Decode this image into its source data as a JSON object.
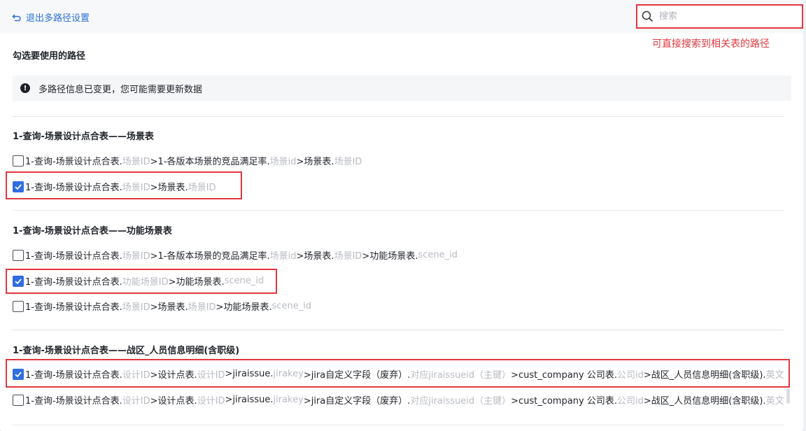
{
  "header": {
    "back_label": "退出多路径设置",
    "search_placeholder": "搜索",
    "search_annotation": "可直接搜索到相关表的路径"
  },
  "section_label": "勾选要使用的路径",
  "notice": "多路径信息已变更，您可能需要更新数据",
  "groups": [
    {
      "title": "1-查询-场景设计点合表——场景表",
      "rows": [
        {
          "checked": false,
          "segments": [
            [
              "1-查询-场景设计点合表.",
              "n"
            ],
            [
              "场景ID",
              "m"
            ],
            [
              ">1-各版本场景的竞品满足率.",
              "n"
            ],
            [
              "场景id",
              "m"
            ],
            [
              ">场景表.",
              "n"
            ],
            [
              "场景ID",
              "m"
            ]
          ]
        },
        {
          "checked": true,
          "segments": [
            [
              "1-查询-场景设计点合表.",
              "n"
            ],
            [
              "场景ID",
              "m"
            ],
            [
              ">场景表.",
              "n"
            ],
            [
              "场景ID",
              "m"
            ]
          ]
        }
      ]
    },
    {
      "title": "1-查询-场景设计点合表——功能场景表",
      "rows": [
        {
          "checked": false,
          "segments": [
            [
              "1-查询-场景设计点合表.",
              "n"
            ],
            [
              "场景ID",
              "m"
            ],
            [
              ">1-各版本场景的竞品满足率.",
              "n"
            ],
            [
              "场景id",
              "m"
            ],
            [
              ">场景表.",
              "n"
            ],
            [
              "场景ID",
              "m"
            ],
            [
              ">功能场景表.",
              "n"
            ],
            [
              "scene_id",
              "m"
            ]
          ]
        },
        {
          "checked": true,
          "segments": [
            [
              "1-查询-场景设计点合表.",
              "n"
            ],
            [
              "功能场景ID",
              "m"
            ],
            [
              ">功能场景表.",
              "n"
            ],
            [
              "scene_id",
              "m"
            ]
          ]
        },
        {
          "checked": false,
          "segments": [
            [
              "1-查询-场景设计点合表.",
              "n"
            ],
            [
              "场景ID",
              "m"
            ],
            [
              ">场景表.",
              "n"
            ],
            [
              "场景ID",
              "m"
            ],
            [
              ">功能场景表.",
              "n"
            ],
            [
              "scene_id",
              "m"
            ]
          ]
        }
      ]
    },
    {
      "title": "1-查询-场景设计点合表——战区_人员信息明细(含职级)",
      "rows": [
        {
          "checked": true,
          "segments": [
            [
              "1-查询-场景设计点合表.",
              "n"
            ],
            [
              "设计ID",
              "m"
            ],
            [
              ">设计点表.",
              "n"
            ],
            [
              "设计ID",
              "m"
            ],
            [
              ">jiraissue.",
              "n"
            ],
            [
              "jirakey",
              "m"
            ],
            [
              ">jira自定义字段（废弃）.",
              "n"
            ],
            [
              "对应jiraissueid（主键）",
              "m"
            ],
            [
              ">cust_company 公司表.",
              "n"
            ],
            [
              "公司id",
              "m"
            ],
            [
              ">战区_人员信息明细(含职级).",
              "n"
            ],
            [
              "英文",
              "m"
            ]
          ]
        },
        {
          "checked": false,
          "segments": [
            [
              "1-查询-场景设计点合表.",
              "n"
            ],
            [
              "设计ID",
              "m"
            ],
            [
              ">设计点表.",
              "n"
            ],
            [
              "设计ID",
              "m"
            ],
            [
              ">jiraissue.",
              "n"
            ],
            [
              "jirakey",
              "m"
            ],
            [
              ">jira自定义字段（废弃）.",
              "n"
            ],
            [
              "对应jiraissueid（主键）",
              "m"
            ],
            [
              ">cust_company 公司表.",
              "n"
            ],
            [
              "公司id",
              "m"
            ],
            [
              ">战区_人员信息明细(含职级).",
              "n"
            ],
            [
              "英文",
              "m"
            ]
          ]
        }
      ]
    }
  ]
}
